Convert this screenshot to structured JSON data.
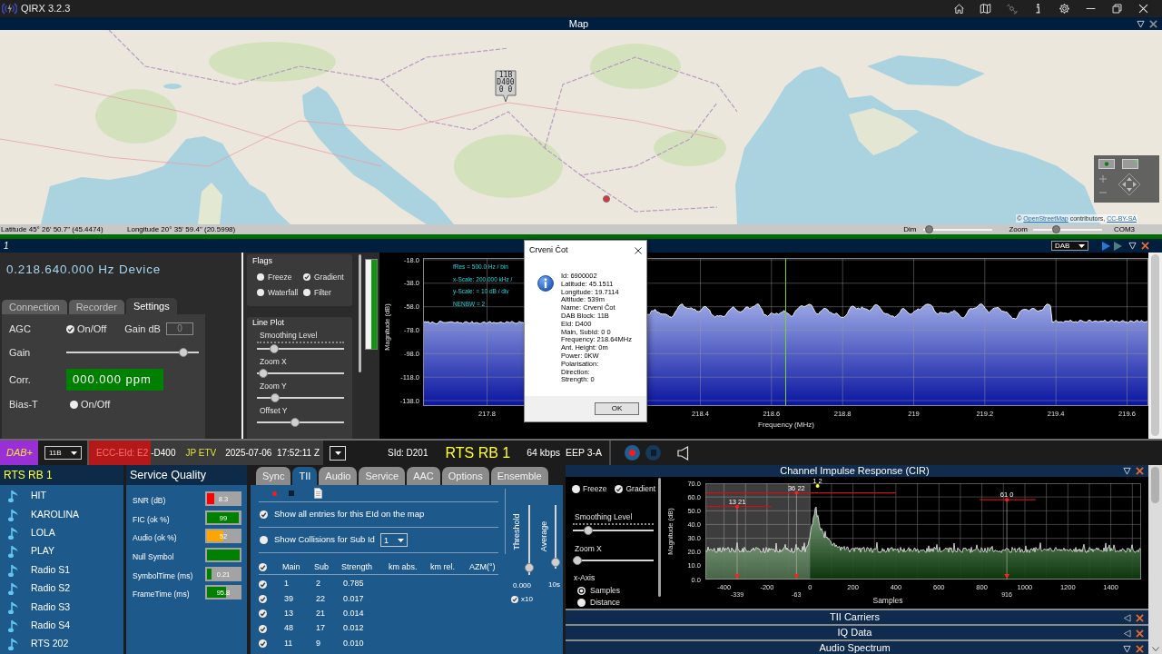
{
  "title_bar": {
    "title": "QIRX 3.2.3"
  },
  "map": {
    "title": "Map",
    "expanded": true,
    "marker": {
      "lines": [
        "11B",
        "D400",
        "0 0"
      ]
    },
    "attribution": [
      {
        "kind": "text",
        "text": "©"
      },
      {
        "kind": "link",
        "text": "OpenStreetMap"
      },
      {
        "kind": "text",
        "text": "contributors,"
      },
      {
        "kind": "link",
        "text": "CC-BY-SA"
      }
    ],
    "status": {
      "latitude": "Latitude 45° 26' 50.7\" (45.4474)",
      "longitude": "Longitude 20° 35' 59.4\" (20.5998)",
      "dim": {
        "label": "Dim",
        "level": 0.03
      },
      "zoom": {
        "label": "Zoom",
        "level": 0.32
      },
      "port": "COM3"
    }
  },
  "receiver": {
    "title": "1",
    "expanded": true,
    "mode": "DAB",
    "frequency": "0.218.640.000 Hz Device",
    "tabs": [
      {
        "label": "Connection",
        "selected": false
      },
      {
        "label": "Recorder",
        "selected": false
      },
      {
        "label": "Settings",
        "selected": true
      }
    ],
    "settings": {
      "agc": {
        "label": "AGC",
        "option": "On/Off",
        "checked": true
      },
      "gain_db": {
        "label": "Gain dB",
        "value": "0",
        "disabled": true
      },
      "gain": {
        "label": "Gain",
        "level": 0.91
      },
      "corr": {
        "label": "Corr.",
        "value": "000.000 ppm"
      },
      "bias_t": {
        "label": "Bias-T",
        "option": "On/Off",
        "checked": false
      }
    },
    "flags": {
      "title": "Flags",
      "options": [
        {
          "label": "Freeze",
          "checked": false
        },
        {
          "label": "Gradient",
          "checked": true
        },
        {
          "label": "Waterfall",
          "checked": false
        },
        {
          "label": "Filter",
          "checked": false
        }
      ]
    },
    "line_plot": {
      "title": "Line Plot",
      "sliders": [
        {
          "label": "Smoothing Level",
          "kind": "ticked",
          "level": 0.16
        },
        {
          "label": "Zoom X",
          "kind": "plain",
          "level": 0.02
        },
        {
          "label": "Zoom Y",
          "kind": "plain",
          "level": 0.17
        },
        {
          "label": "Offset Y",
          "kind": "plain",
          "level": 0.43
        }
      ]
    },
    "spectrum": {
      "annotations": [
        "fRes = 500.0 Hz / bin",
        "x-Scale: 200.000 kHz /",
        "y-Scale: = 10 dB / div",
        "NENBW = 2"
      ],
      "ylabel": "Magnitude (dB)",
      "xlabel": "Frequency (MHz)",
      "yticks": [
        "-18.0",
        "-38.0",
        "-58.0",
        "-78.0",
        "-98.0",
        "-118.0",
        "-138.0"
      ],
      "xticks": [
        "217.8",
        "218.4",
        "218.6",
        "218.8",
        "219",
        "219.2",
        "219.4",
        "219.6"
      ]
    }
  },
  "dialog": {
    "title": "Crveni Čot",
    "lines": [
      "Id: 6900002",
      "Latitude: 45.1511",
      "Longitude: 19.7114",
      "Altitude: 539m",
      "Name: Crveni Čot",
      "DAB Block: 11B",
      "EId: D400",
      "Main, SubId: 0 0",
      "Frequency: 218.64MHz",
      "Ant. Height: 0m",
      "Power: 0KW",
      "Polarisation:",
      "Direction:",
      "Strength: 0"
    ],
    "button": "OK"
  },
  "status_strip": {
    "mode": "DAB+",
    "channel": "11B",
    "ecc": "ECC-EId: E2",
    "eid": "-D400",
    "ensemble": "JP ETV",
    "timestamp": "2025-07-06  17:52:11 Z",
    "sid": "SId: D201",
    "service": "RTS RB 1",
    "bitrate": "64 kbps",
    "protection": "EEP 3-A"
  },
  "services": {
    "header": "RTS RB 1",
    "items": [
      "HIT",
      "KAROLINA",
      "LOLA",
      "PLAY",
      "Radio S1",
      "Radio S2",
      "Radio S3",
      "Radio S4",
      "RTS 202"
    ]
  },
  "quality": {
    "title": "Service Quality",
    "rows": [
      {
        "label": "SNR (dB)",
        "value": "8.3",
        "level": 0.23,
        "color": "#ff0000"
      },
      {
        "label": "FIC (ok %)",
        "value": "99",
        "level": 0.98,
        "color": "#008000"
      },
      {
        "label": "Audio (ok %)",
        "value": "52",
        "level": 0.51,
        "color": "#ffa500"
      },
      {
        "label": "Null Symbol",
        "level": 1,
        "color": "#008000"
      },
      {
        "label": "SymbolTime (ms)",
        "value": "0.21",
        "level": 0.13,
        "color": "#008000"
      },
      {
        "label": "FrameTime (ms)",
        "value": "95.8",
        "level": 0.58,
        "color": "#008000"
      }
    ]
  },
  "tii": {
    "tabs": [
      {
        "label": "Sync",
        "selected": false
      },
      {
        "label": "TII",
        "selected": true
      },
      {
        "label": "Audio",
        "selected": false
      },
      {
        "label": "Service",
        "selected": false
      },
      {
        "label": "AAC",
        "selected": false
      },
      {
        "label": "Options",
        "selected": false
      },
      {
        "label": "Ensemble",
        "selected": false
      }
    ],
    "show_all": {
      "label": "Show all entries for this EId on the map",
      "checked": true
    },
    "collisions": {
      "label": "Show Collisions for Sub Id",
      "checked": false,
      "sub_id": "1"
    },
    "table": {
      "all_checked": true,
      "columns": [
        "Main",
        "Sub",
        "Strength",
        "km abs.",
        "km rel.",
        "AZM(°)"
      ],
      "rows": [
        {
          "checked": true,
          "cells": [
            "1",
            "2",
            "0.785"
          ]
        },
        {
          "checked": true,
          "cells": [
            "39",
            "22",
            "0.017"
          ]
        },
        {
          "checked": true,
          "cells": [
            "13",
            "21",
            "0.014"
          ]
        },
        {
          "checked": true,
          "cells": [
            "48",
            "17",
            "0.012"
          ]
        },
        {
          "checked": true,
          "cells": [
            "11",
            "9",
            "0.010"
          ]
        }
      ]
    },
    "threshold": {
      "label": "Threshold",
      "value": "0.000",
      "level": 0.04
    },
    "average": {
      "label": "Average",
      "value": "10s",
      "level": 0.04
    },
    "x10": {
      "label": "x10",
      "checked": true
    }
  },
  "cir": {
    "title": "Channel Impulse Response (CIR)",
    "expanded": true,
    "options": [
      {
        "label": "Freeze",
        "checked": false
      },
      {
        "label": "Gradient",
        "checked": true
      }
    ],
    "sliders": [
      {
        "label": "Smoothing Level",
        "kind": "ticked",
        "level": 0.15
      },
      {
        "label": "Zoom X",
        "kind": "plain",
        "level": 0
      }
    ],
    "x_axis": {
      "label": "x-Axis",
      "options": [
        {
          "label": "Samples",
          "selected": true
        },
        {
          "label": "Distance",
          "selected": false
        }
      ]
    },
    "chart": {
      "ylabel": "Magnitude (dB)",
      "xlabel": "Samples",
      "yticks": [
        "70.0",
        "60.0",
        "50.0",
        "40.0",
        "30.0",
        "20.0",
        "10.0",
        "0.0"
      ],
      "xticks": [
        "-400",
        "-200",
        "0",
        "200",
        "400",
        "600",
        "800",
        "1000",
        "1200",
        "1400"
      ],
      "peak_label": "1 2",
      "markers": [
        {
          "label": "13 21",
          "sample": "-339"
        },
        {
          "label": "36 22",
          "sample": "-63"
        },
        {
          "label": "61 0",
          "sample": "916"
        }
      ]
    }
  },
  "panels": [
    {
      "title": "TII Carriers",
      "expanded": false
    },
    {
      "title": "IQ Data",
      "expanded": false
    },
    {
      "title": "Audio Spectrum",
      "expanded": true
    }
  ]
}
